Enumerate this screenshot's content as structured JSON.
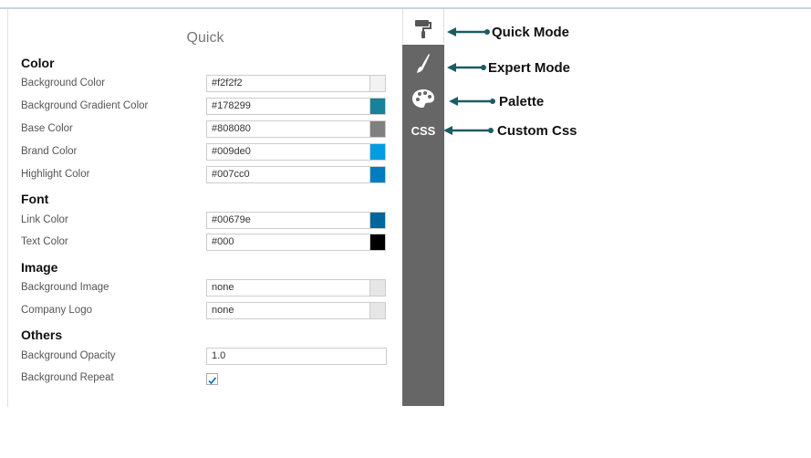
{
  "panel": {
    "title": "Quick"
  },
  "sections": {
    "color": "Color",
    "font": "Font",
    "image": "Image",
    "others": "Others"
  },
  "fields": {
    "background_color": {
      "label": "Background Color",
      "value": "#f2f2f2",
      "swatch": "#f2f2f2"
    },
    "background_gradient_color": {
      "label": "Background Gradient Color",
      "value": "#178299",
      "swatch": "#178299"
    },
    "base_color": {
      "label": "Base Color",
      "value": "#808080",
      "swatch": "#808080"
    },
    "brand_color": {
      "label": "Brand Color",
      "value": "#009de0",
      "swatch": "#009de0"
    },
    "highlight_color": {
      "label": "Highlight Color",
      "value": "#007cc0",
      "swatch": "#007cc0"
    },
    "link_color": {
      "label": "Link Color",
      "value": "#00679e",
      "swatch": "#00679e"
    },
    "text_color": {
      "label": "Text Color",
      "value": "#000",
      "swatch": "#000000"
    },
    "background_image": {
      "label": "Background Image",
      "value": "none",
      "swatch": "#e6e6e6"
    },
    "company_logo": {
      "label": "Company Logo",
      "value": "none",
      "swatch": "#e6e6e6"
    },
    "background_opacity": {
      "label": "Background Opacity",
      "value": "1.0"
    },
    "background_repeat": {
      "label": "Background Repeat",
      "checked": true
    }
  },
  "sidebar": {
    "tabs": [
      {
        "icon": "paint-roller-icon",
        "active": true
      },
      {
        "icon": "brush-icon"
      },
      {
        "icon": "palette-icon"
      },
      {
        "icon": "css-icon",
        "label": "CSS"
      }
    ],
    "bg_color": "#666666"
  },
  "annotations": {
    "quick_mode": "Quick Mode",
    "expert_mode": "Expert Mode",
    "palette": "Palette",
    "custom_css": "Custom Css",
    "arrow_color": "#1d5c63"
  }
}
